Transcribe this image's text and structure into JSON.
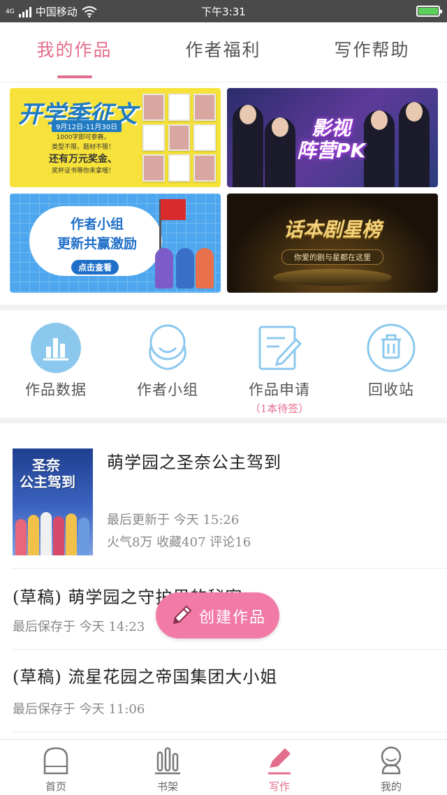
{
  "status_bar": {
    "carrier": "中国移动",
    "network": "4G",
    "time": "下午3:31"
  },
  "tabs": [
    {
      "label": "我的作品",
      "active": true
    },
    {
      "label": "作者福利",
      "active": false
    },
    {
      "label": "写作帮助",
      "active": false
    }
  ],
  "banners": {
    "b1": {
      "title": "开学季征文",
      "date": "9月12日-11月30日",
      "line1": "1000字即可参赛，",
      "line2": "类型不限，题材不限！",
      "line3": "还有万元奖金、",
      "line4": "奖杯证书等你来拿哦！"
    },
    "b2": {
      "title_line1": "影视",
      "title_line2": "阵营PK"
    },
    "b3": {
      "title_line1": "作者小组",
      "title_line2": "更新共赢激励",
      "button": "点击查看"
    },
    "b4": {
      "title": "话本剧星榜",
      "sub": "你爱的剧与星都在这里"
    }
  },
  "quick_actions": [
    {
      "label": "作品数据",
      "icon": "bar-chart-icon"
    },
    {
      "label": "作者小组",
      "icon": "group-icon"
    },
    {
      "label": "作品申请",
      "icon": "edit-document-icon",
      "sub": "（1本待签）"
    },
    {
      "label": "回收站",
      "icon": "trash-icon"
    }
  ],
  "works": [
    {
      "title": "萌学园之圣奈公主驾到",
      "cover_text_line1": "圣奈",
      "cover_text_line2": "公主驾到",
      "last_update": "最后更新于 今天 15:26",
      "stats": "火气8万 收藏407 评论16"
    },
    {
      "title": "(草稿) 萌学园之守护里的秘密",
      "last_update": "最后保存于 今天 14:23"
    },
    {
      "title": "(草稿) 流星花园之帝国集团大小姐",
      "last_update": "最后保存于 今天 11:06"
    }
  ],
  "fab": {
    "label": "创建作品",
    "icon": "pencil-icon"
  },
  "bottom_nav": [
    {
      "label": "首页",
      "icon": "home-icon",
      "active": false
    },
    {
      "label": "书架",
      "icon": "bookshelf-icon",
      "active": false
    },
    {
      "label": "写作",
      "icon": "pen-icon",
      "active": true
    },
    {
      "label": "我的",
      "icon": "profile-icon",
      "active": false
    }
  ],
  "colors": {
    "accent": "#e26d8c",
    "fab": "#f27aa6",
    "icon_blue": "#8cc8ee"
  }
}
